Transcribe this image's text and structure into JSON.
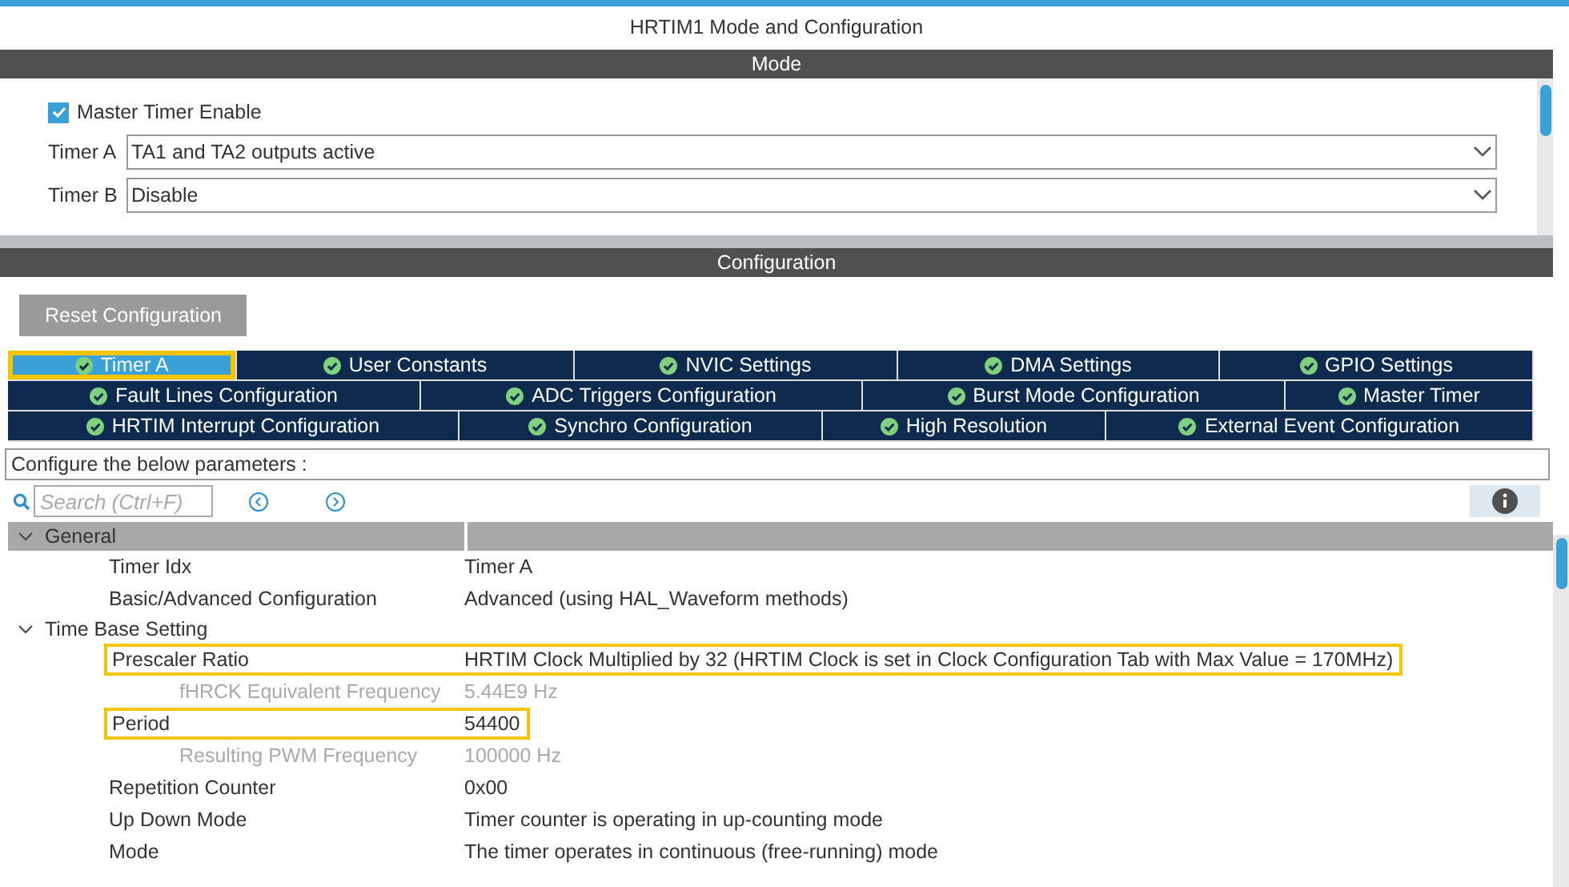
{
  "window": {
    "title": "HRTIM1 Mode and Configuration"
  },
  "mode": {
    "header": "Mode",
    "master_timer": {
      "label": "Master Timer Enable",
      "checked": true
    },
    "fields": [
      {
        "label": "Timer A",
        "value": "TA1 and TA2 outputs active"
      },
      {
        "label": "Timer B",
        "value": "Disable"
      }
    ]
  },
  "configuration": {
    "header": "Configuration",
    "reset_button": "Reset Configuration",
    "tab_rows": [
      [
        {
          "label": "Timer A",
          "selected": true,
          "highlighted": true
        },
        {
          "label": "User Constants",
          "selected": false,
          "highlighted": false
        },
        {
          "label": "NVIC Settings",
          "selected": false,
          "highlighted": false
        },
        {
          "label": "DMA Settings",
          "selected": false,
          "highlighted": false
        },
        {
          "label": "GPIO Settings",
          "selected": false,
          "highlighted": false
        }
      ],
      [
        {
          "label": "Fault Lines Configuration",
          "selected": false,
          "highlighted": false
        },
        {
          "label": "ADC Triggers Configuration",
          "selected": false,
          "highlighted": false
        },
        {
          "label": "Burst Mode Configuration",
          "selected": false,
          "highlighted": false
        },
        {
          "label": "Master Timer",
          "selected": false,
          "highlighted": false
        }
      ],
      [
        {
          "label": "HRTIM Interrupt Configuration",
          "selected": false,
          "highlighted": false
        },
        {
          "label": "Synchro Configuration",
          "selected": false,
          "highlighted": false
        },
        {
          "label": "High Resolution",
          "selected": false,
          "highlighted": false
        },
        {
          "label": "External Event Configuration",
          "selected": false,
          "highlighted": false
        }
      ]
    ],
    "hint": "Configure the below parameters :",
    "search": {
      "placeholder": "Search (Ctrl+F)"
    },
    "groups": [
      {
        "label": "General",
        "expanded": true,
        "header": true,
        "children": [
          {
            "name": "Timer Idx",
            "value": "Timer A",
            "disabled": false,
            "highlighted": false
          },
          {
            "name": "Basic/Advanced Configuration",
            "value": "Advanced (using HAL_Waveform methods)",
            "disabled": false,
            "highlighted": false
          }
        ]
      },
      {
        "label": "Time Base Setting",
        "expanded": true,
        "header": false,
        "children": [
          {
            "name": "Prescaler Ratio",
            "value": "HRTIM Clock Multiplied by 32 (HRTIM Clock is set in Clock Configuration Tab with Max Value = 170MHz)",
            "disabled": false,
            "highlighted": true
          },
          {
            "name": "fHRCK Equivalent Frequency",
            "value": "5.44E9 Hz",
            "disabled": true,
            "highlighted": false
          },
          {
            "name": "Period",
            "value": "54400",
            "disabled": false,
            "highlighted": true
          },
          {
            "name": "Resulting PWM Frequency",
            "value": "100000 Hz",
            "disabled": true,
            "highlighted": false
          },
          {
            "name": "Repetition Counter",
            "value": "0x00",
            "disabled": false,
            "highlighted": false
          },
          {
            "name": "Up Down Mode",
            "value": "Timer counter is operating in up-counting mode",
            "disabled": false,
            "highlighted": false
          },
          {
            "name": "Mode",
            "value": "The timer operates in continuous (free-running) mode",
            "disabled": false,
            "highlighted": false
          }
        ]
      }
    ]
  }
}
